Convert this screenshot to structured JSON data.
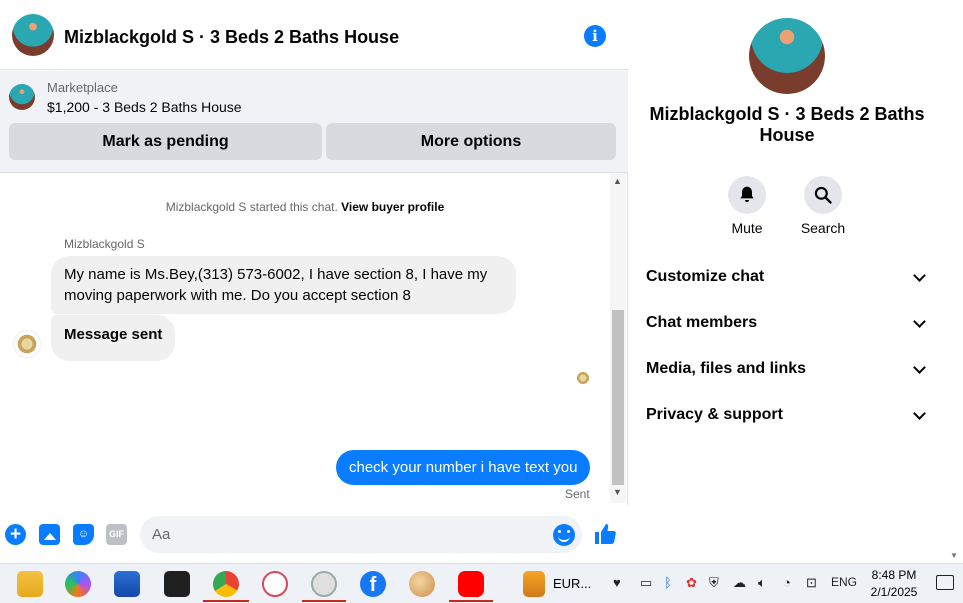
{
  "header": {
    "title": "Mizblackgold S · 3 Beds 2 Baths House"
  },
  "marketplace": {
    "label": "Marketplace",
    "item": "$1,200 - 3 Beds 2 Baths House",
    "pending_button": "Mark as pending",
    "more_button": "More options"
  },
  "conversation": {
    "system_prefix": "Mizblackgold S started this chat.",
    "system_link": "View buyer profile",
    "sender_name": "Mizblackgold S",
    "incoming": [
      "My name is Ms.Bey,(313) 573-6002, I have section 8, I have my moving paperwork with me. Do you accept section 8",
      "Message sent"
    ],
    "outgoing": "check your number i have text you",
    "outgoing_status": "Sent"
  },
  "composer": {
    "placeholder": "Aa",
    "gif_label": "GIF"
  },
  "details": {
    "title": "Mizblackgold S · 3 Beds 2 Baths House",
    "actions": [
      "Mute",
      "Search"
    ],
    "sections": [
      "Customize chat",
      "Chat members",
      "Media, files and links",
      "Privacy & support"
    ]
  },
  "taskbar": {
    "pinned_label": "EUR...",
    "language": "ENG",
    "time": "8:48 PM",
    "date": "2/1/2025"
  },
  "colors": {
    "accent": "#0a7cff",
    "bubble_in": "#f0f0f0",
    "secondary_text": "#65676b",
    "button_gray": "#d8dadf"
  }
}
